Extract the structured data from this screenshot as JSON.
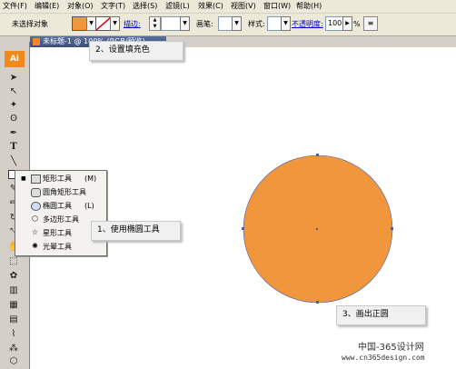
{
  "menu": [
    "文件(F)",
    "编辑(E)",
    "对象(O)",
    "文字(T)",
    "选择(S)",
    "滤镜(L)",
    "效果(C)",
    "视图(V)",
    "窗口(W)",
    "帮助(H)"
  ],
  "controlbar": {
    "selection_status": "未选择对象",
    "fill_color": "#f0963c",
    "stroke_label": "描边:",
    "brush_label": "画笔:",
    "style_label": "样式:",
    "opacity_label": "不透明度:",
    "opacity_value": "100",
    "opacity_unit": "%"
  },
  "app_logo": "Ai",
  "document": {
    "tab_title": "未标题-1 @ 100% (RGB/预览)"
  },
  "flyout": {
    "items": [
      {
        "label": "矩形工具",
        "shortcut": "(M)",
        "icon": "rectangle-icon",
        "active": true
      },
      {
        "label": "圆角矩形工具",
        "shortcut": "",
        "icon": "rounded-rectangle-icon",
        "active": false
      },
      {
        "label": "椭圆工具",
        "shortcut": "(L)",
        "icon": "ellipse-icon",
        "active": false
      },
      {
        "label": "多边形工具",
        "shortcut": "",
        "icon": "polygon-icon",
        "active": false
      },
      {
        "label": "星形工具",
        "shortcut": "",
        "icon": "star-icon",
        "active": false
      },
      {
        "label": "光晕工具",
        "shortcut": "",
        "icon": "flare-icon",
        "active": false
      }
    ]
  },
  "annotations": {
    "step1": "1、使用椭圆工具",
    "step2": "2、设置填充色",
    "step3": "3、画出正圆"
  },
  "circle_color": "#f0963c",
  "watermark": {
    "line1": "中国-365设计网",
    "line2": "www.cn365design.com"
  }
}
